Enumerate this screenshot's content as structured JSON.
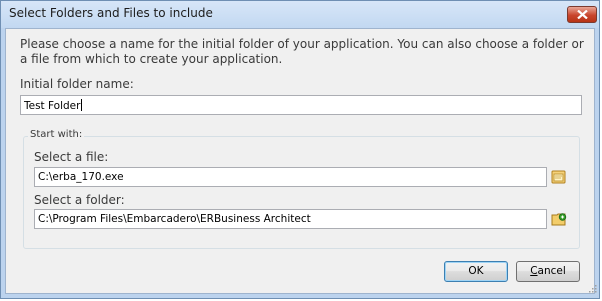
{
  "window": {
    "title": "Select Folders and Files to include"
  },
  "intro_text": "Please choose a name for the initial folder of your application. You can also choose a folder or a file from which to create your application.",
  "initial_folder": {
    "label": "Initial folder name:",
    "value": "Test Folder"
  },
  "start_with": {
    "caption": "Start with:",
    "file": {
      "label": "Select a file:",
      "value": "C:\\erba_170.exe"
    },
    "folder": {
      "label": "Select a folder:",
      "value": "C:\\Program Files\\Embarcadero\\ERBusiness Architect"
    }
  },
  "buttons": {
    "ok": "OK",
    "cancel_first": "C",
    "cancel_rest": "ancel"
  },
  "icons": {
    "close": "close-icon",
    "file_browse": "open-file-icon",
    "folder_browse": "browse-folder-icon"
  }
}
